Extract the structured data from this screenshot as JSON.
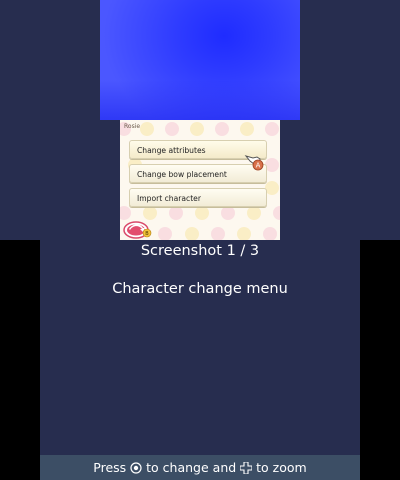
{
  "top_screen": {
    "background": "#2f3cff"
  },
  "bottom_screen": {
    "character_name": "Rosie",
    "menu": [
      {
        "label": "Change attributes",
        "selected": true
      },
      {
        "label": "Change bow placement",
        "selected": false
      },
      {
        "label": "Import character",
        "selected": false
      }
    ],
    "cursor_button": "A",
    "back_button": "B"
  },
  "caption": {
    "title": "Screenshot 1 / 3",
    "description": "Character change menu"
  },
  "footer": {
    "prefix": "Press",
    "middle": "to change and",
    "suffix": "to zoom"
  },
  "colors": {
    "page_background": "#272d4f",
    "footer_bar": "#3c4e65",
    "letterbox": "#000000"
  }
}
